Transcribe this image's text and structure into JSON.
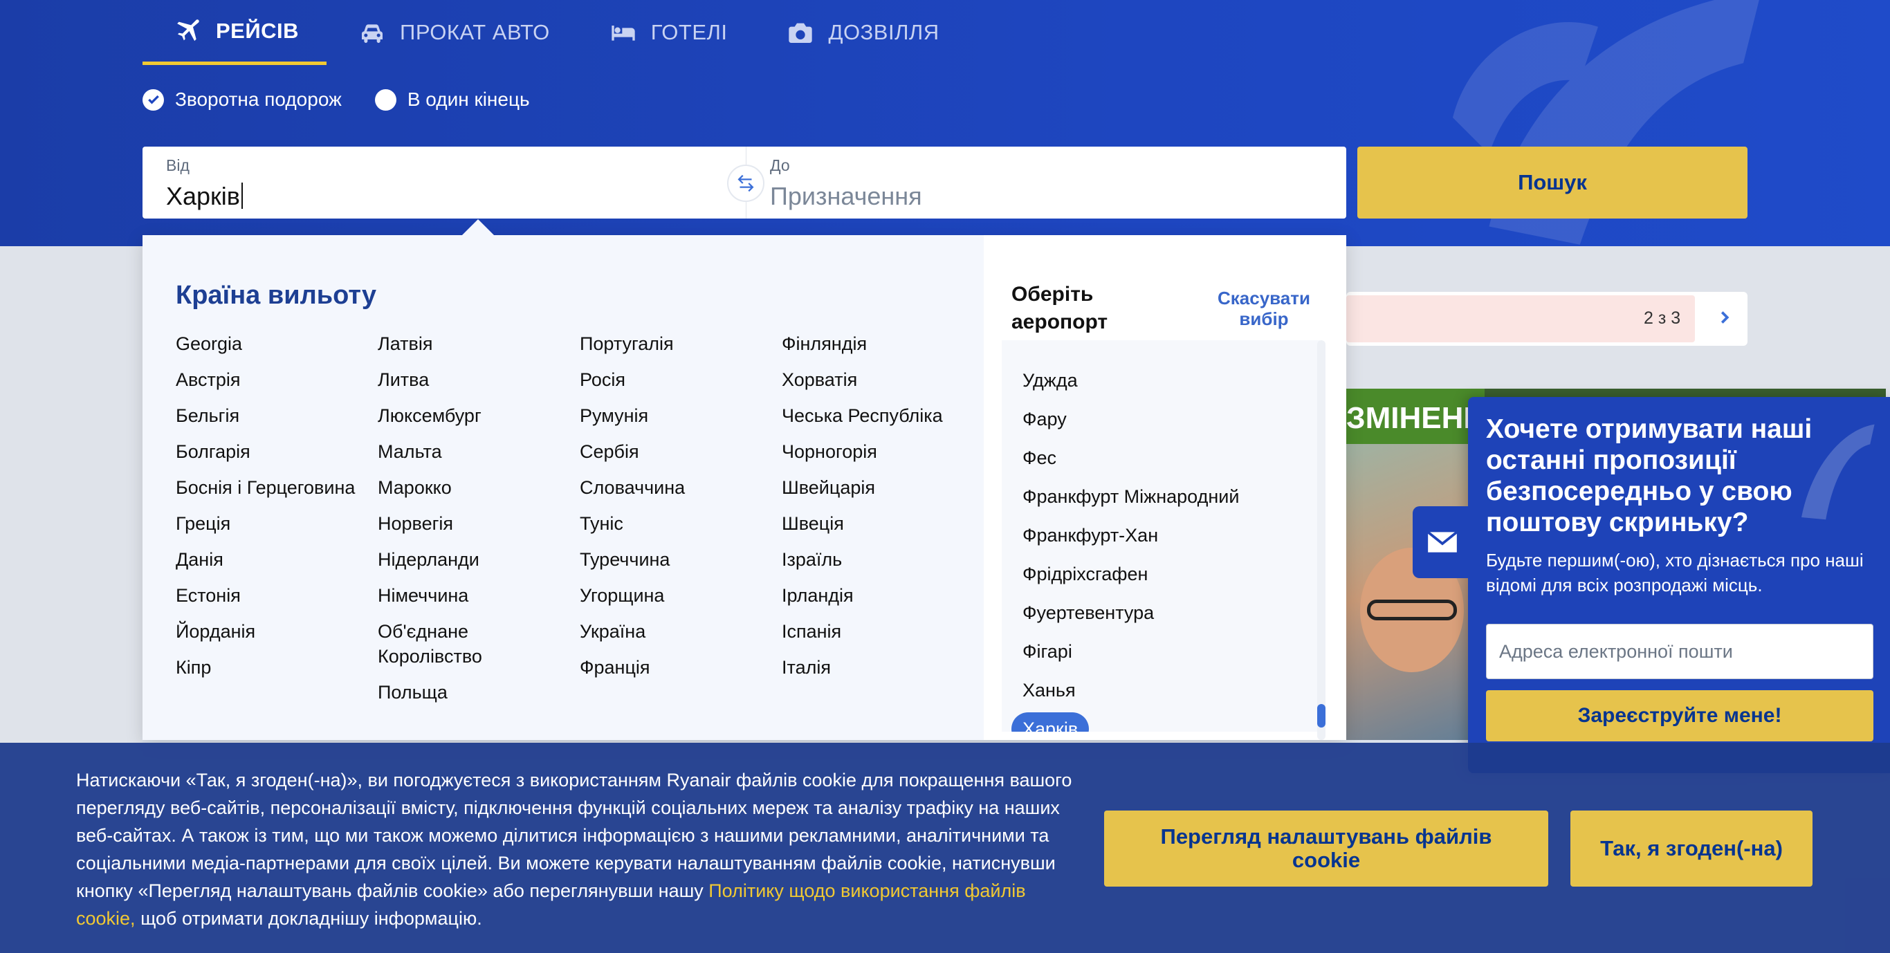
{
  "tabs": [
    {
      "label": "РЕЙСІВ",
      "icon": "plane-icon",
      "active": true
    },
    {
      "label": "ПРОКАТ АВТО",
      "icon": "car-icon",
      "active": false
    },
    {
      "label": "ГОТЕЛІ",
      "icon": "bed-icon",
      "active": false
    },
    {
      "label": "ДОЗВІЛЛЯ",
      "icon": "camera-icon",
      "active": false
    }
  ],
  "trip_type": {
    "return_label": "Зворотна подорож",
    "one_way_label": "В один кінець",
    "selected": "return"
  },
  "search": {
    "from_label": "Від",
    "from_value": "Харків",
    "to_label": "До",
    "to_placeholder": "Призначення",
    "button_label": "Пошук"
  },
  "countries": {
    "title": "Країна вильоту",
    "columns": [
      [
        "Georgia",
        "Австрія",
        "Бельгія",
        "Болгарія",
        "Боснія і Герцеговина",
        "Греція",
        "Данія",
        "Естонія",
        "Йорданія",
        "Кіпр"
      ],
      [
        "Латвія",
        "Литва",
        "Люксембург",
        "Мальта",
        "Марокко",
        "Норвегія",
        "Нідерланди",
        "Німеччина",
        "Об'єднане Королівство",
        "Польща"
      ],
      [
        "Португалія",
        "Росія",
        "Румунія",
        "Сербія",
        "Словаччина",
        "Туніс",
        "Туреччина",
        "Угорщина",
        "Україна",
        "Франція"
      ],
      [
        "Фінляндія",
        "Хорватія",
        "Чеська Республіка",
        "Чорногорія",
        "Швейцарія",
        "Швеція",
        "Ізраїль",
        "Ірландія",
        "Іспанія",
        "Італія"
      ]
    ]
  },
  "airports": {
    "title": "Оберіть аеропорт",
    "clear_label": "Скасувати вибір",
    "items": [
      "Удждa",
      "Фару",
      "Фес",
      "Франкфурт Міжнародний",
      "Франкфурт-Хан",
      "Фрідріхсгафен",
      "Фуертевентура",
      "Фігарі",
      "Ханья",
      "Харків"
    ],
    "selected": "Харків"
  },
  "background": {
    "carousel_count": "2 з 3",
    "banner_text": "ЗМІНЕННЯ"
  },
  "newsletter": {
    "title": "Хочете отримувати наші останні пропозиції безпосередньо у свою поштову скриньку?",
    "text": "Будьте першим(-ою), хто дізнається про наші відомі для всіх розпродажі місць.",
    "email_placeholder": "Адреса електронної пошти",
    "button_label": "Зареєструйте мене!"
  },
  "cookie": {
    "text_before": "Натискаючи «Так, я згоден(-на)», ви погоджуєтеся з використанням Ryanair файлів cookie для покращення вашого перегляду веб-сайтів, персоналізації вмісту, підключення функцій соціальних мереж та аналізу трафіку на наших веб-сайтах. А також із тим, що ми також можемо ділитися інформацією з нашими рекламними, аналітичними та соціальними медіа-партнерами для своїх цілей. Ви можете керувати налаштуванням файлів cookie, натиснувши кнопку «Перегляд налаштувань файлів cookie» або переглянувши нашу ",
    "link_text": "Політику щодо використання файлів cookie,",
    "text_after": " щоб отримати докладнішу інформацію.",
    "settings_label": "Перегляд налаштувань файлів cookie",
    "accept_label": "Так, я згоден(-на)"
  },
  "colors": {
    "brand_blue": "#073590",
    "hero_blue": "#1e46c0",
    "accent_yellow": "#e6c34c",
    "selected_blue": "#3b6fd8"
  }
}
